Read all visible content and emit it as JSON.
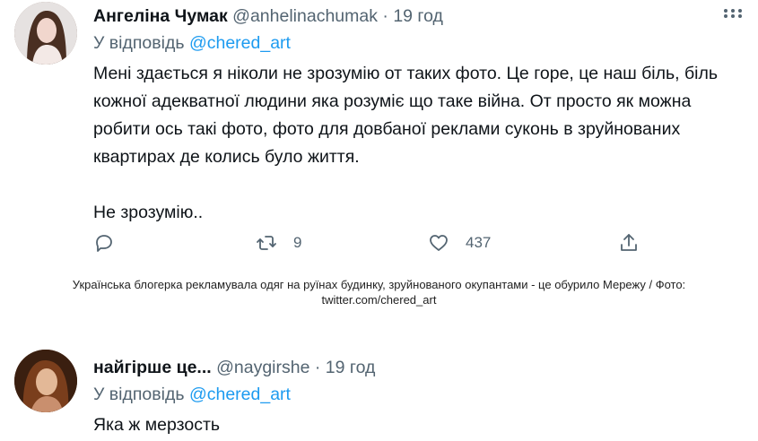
{
  "tweets": [
    {
      "name": "Ангеліна Чумак",
      "handle": "@anhelinachumak",
      "separator": "·",
      "time": "19 год",
      "reply_prefix": "У відповідь",
      "reply_to": "@chered_art",
      "paragraphs": [
        "Мені здається я ніколи не зрозумію от таких фото. Це горе, це наш біль, біль кожної адекватної людини яка розуміє що таке війна. От просто як можна робити ось такі фото, фото для довбаної реклами суконь в зруйнованих квартирах де колись було життя.",
        "Не зрозумію.."
      ],
      "actions": {
        "reply": {
          "icon": "reply-icon",
          "count": ""
        },
        "retweet": {
          "icon": "retweet-icon",
          "count": "9"
        },
        "like": {
          "icon": "heart-icon",
          "count": "437"
        },
        "share": {
          "icon": "share-icon",
          "count": ""
        }
      }
    },
    {
      "name": "найгірше це...",
      "handle": "@naygirshe",
      "separator": "·",
      "time": "19 год",
      "reply_prefix": "У відповідь",
      "reply_to": "@chered_art",
      "paragraphs": [
        "Яка ж мерзость"
      ]
    }
  ],
  "caption": {
    "line1": "Українська блогерка рекламувала одяг на руїнах будинку, зруйнованого окупантами - це обурило Мережу / Фото:",
    "line2": "twitter.com/chered_art"
  },
  "colors": {
    "text": "#0f1419",
    "secondary": "#536471",
    "link": "#1d9bf0"
  }
}
